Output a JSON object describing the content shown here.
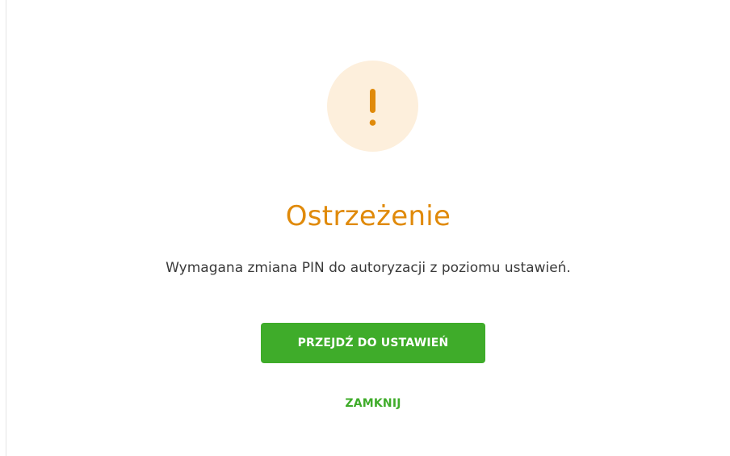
{
  "dialog": {
    "icon": "exclamation-icon",
    "title": "Ostrzeżenie",
    "message": "Wymagana zmiana PIN do autoryzacji z poziomu ustawień.",
    "primary_button_label": "PRZEJDŹ DO USTAWIEŃ",
    "close_button_label": "ZAMKNIJ"
  },
  "colors": {
    "warning_accent": "#e08a0a",
    "warning_circle_bg": "#fdefdc",
    "primary_green": "#3fac2a",
    "text": "#3a3a3a"
  }
}
